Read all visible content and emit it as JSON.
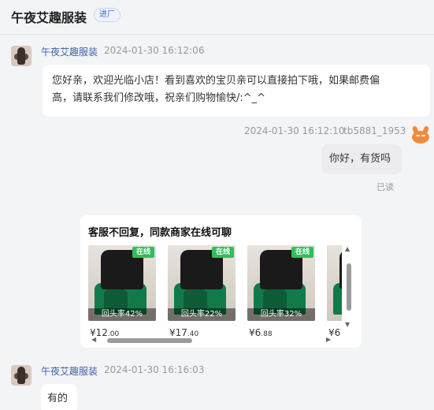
{
  "header": {
    "title": "午夜艾趣服装",
    "tag": "进厂"
  },
  "messages": [
    {
      "sender": "午夜艾趣服装",
      "time": "2024-01-30 16:12:06",
      "lines": [
        "您好亲，欢迎光临小店！看到喜欢的宝贝亲可以直接拍下哦，如果邮费偏",
        "高，请联系我们修改哦，祝亲们购物愉快/:^_^"
      ]
    },
    {
      "time": "2024-01-30 16:12:10",
      "sender": "tb5881_1953",
      "text": "你好，有货吗",
      "status": "已读"
    },
    {
      "sender": "午夜艾趣服装",
      "time": "2024-01-30 16:16:03",
      "text": "有的"
    }
  ],
  "recommend_card": {
    "title": "客服不回复，同款商家在线可聊",
    "products": [
      {
        "badge": "在线",
        "return_rate": "回头率42%",
        "price_int": "¥12",
        "price_dec": ".00"
      },
      {
        "badge": "在线",
        "return_rate": "回头率22%",
        "price_int": "¥17",
        "price_dec": ".40"
      },
      {
        "badge": "在线",
        "return_rate": "回头率32%",
        "price_int": "¥6",
        "price_dec": ".88"
      },
      {
        "badge": "",
        "return_rate": "",
        "price_int": "¥6",
        "price_dec": ""
      }
    ]
  },
  "icons": {
    "shop_avatar": "shop-avatar-icon",
    "user_avatar": "devil-emoji-icon",
    "scroll_up": "▲",
    "scroll_down": "▼",
    "scroll_left": "◀",
    "scroll_right": "▶"
  },
  "colors": {
    "accent": "#3f5fa8",
    "online": "#2fbf5b",
    "tag": "#3d6bd8"
  }
}
